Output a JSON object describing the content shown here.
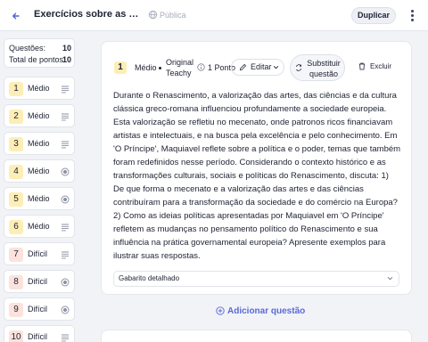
{
  "header": {
    "back_icon": "arrow-left-icon",
    "title": "Exercícios sobre as principais...",
    "visibility": "Pública",
    "duplicate_label": "Duplicar",
    "menu_icon": "more-vertical-icon"
  },
  "summary": {
    "questions_label": "Questões:",
    "questions_value": "10",
    "points_label": "Total de pontos:",
    "points_value": "10"
  },
  "questions": [
    {
      "number": "1",
      "difficulty": "Médio",
      "icon": "lines-icon"
    },
    {
      "number": "2",
      "difficulty": "Médio",
      "icon": "lines-icon"
    },
    {
      "number": "3",
      "difficulty": "Médio",
      "icon": "lines-icon"
    },
    {
      "number": "4",
      "difficulty": "Médio",
      "icon": "radio-icon"
    },
    {
      "number": "5",
      "difficulty": "Médio",
      "icon": "radio-icon"
    },
    {
      "number": "6",
      "difficulty": "Médio",
      "icon": "lines-icon"
    },
    {
      "number": "7",
      "difficulty": "Difícil",
      "icon": "lines-icon"
    },
    {
      "number": "8",
      "difficulty": "Difícil",
      "icon": "radio-icon"
    },
    {
      "number": "9",
      "difficulty": "Difícil",
      "icon": "radio-icon"
    },
    {
      "number": "10",
      "difficulty": "Difícil",
      "icon": "lines-icon"
    }
  ],
  "card": {
    "number": "1",
    "difficulty": "Médio",
    "source": "Original Teachy",
    "points": "1 Ponto",
    "edit_label": "Editar",
    "substitute_label": "Substituir questão",
    "delete_label": "Excluir",
    "question_text": "Durante o Renascimento, a valorização das artes, das ciências e da cultura clássica greco-romana influenciou profundamente a sociedade europeia. Esta valorização se refletiu no mecenato, onde patronos ricos financiavam artistas e intelectuais, e na busca pela excelência e pelo conhecimento. Em 'O Príncipe', Maquiavel reflete sobre a política e o poder, temas que também foram redefinidos nesse período. Considerando o contexto histórico e as transformações culturais, sociais e políticas do Renascimento, discuta: 1) De que forma o mecenato e a valorização das artes e das ciências contribuíram para a transformação da sociedade e do comércio na Europa? 2) Como as ideias políticas apresentadas por Maquiavel em 'O Príncipe' refletem as mudanças no pensamento político do Renascimento e sua influência na prática governamental europeia? Apresente exemplos para ilustrar suas respostas.",
    "answer_label": "Gabarito detalhado"
  },
  "add_question_label": "Adicionar questão",
  "colors": {
    "accent": "#5a6ad6",
    "medium_badge": "#fdeeb5",
    "hard_badge": "#fbe2dc",
    "background": "#f1f3f7"
  }
}
